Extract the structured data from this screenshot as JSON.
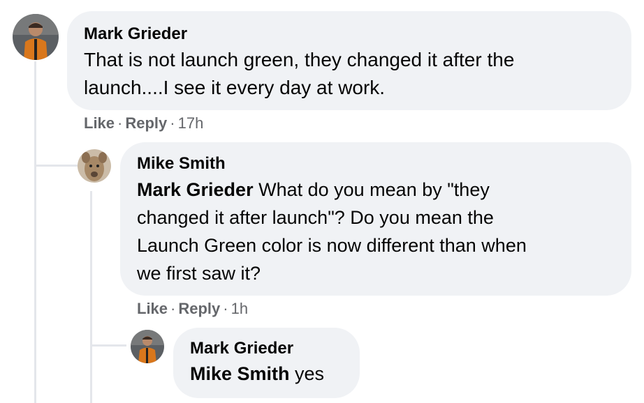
{
  "comments": [
    {
      "author": "Mark Grieder",
      "text": "That is not launch green, they changed it after the launch....I see it every day at work.",
      "line1": "That is not launch green, they changed it after the",
      "line2": "launch....I see it every day at work.",
      "actions": {
        "like": "Like",
        "reply": "Reply",
        "time": "17h"
      }
    },
    {
      "author": "Mike Smith",
      "mention": "Mark Grieder",
      "line1": " What do you mean by \"they",
      "line2": "changed it after launch\"? Do you mean the",
      "line3": "Launch Green color is now different than when",
      "line4": "we first saw it?",
      "actions": {
        "like": "Like",
        "reply": "Reply",
        "time": "1h"
      }
    },
    {
      "author": "Mark Grieder",
      "mention": "Mike Smith",
      "text": " yes"
    }
  ],
  "separator": "·",
  "colors": {
    "bubble": "#f0f2f5",
    "meta": "#65676b",
    "text": "#050505",
    "thread_line": "#e4e6eb"
  }
}
